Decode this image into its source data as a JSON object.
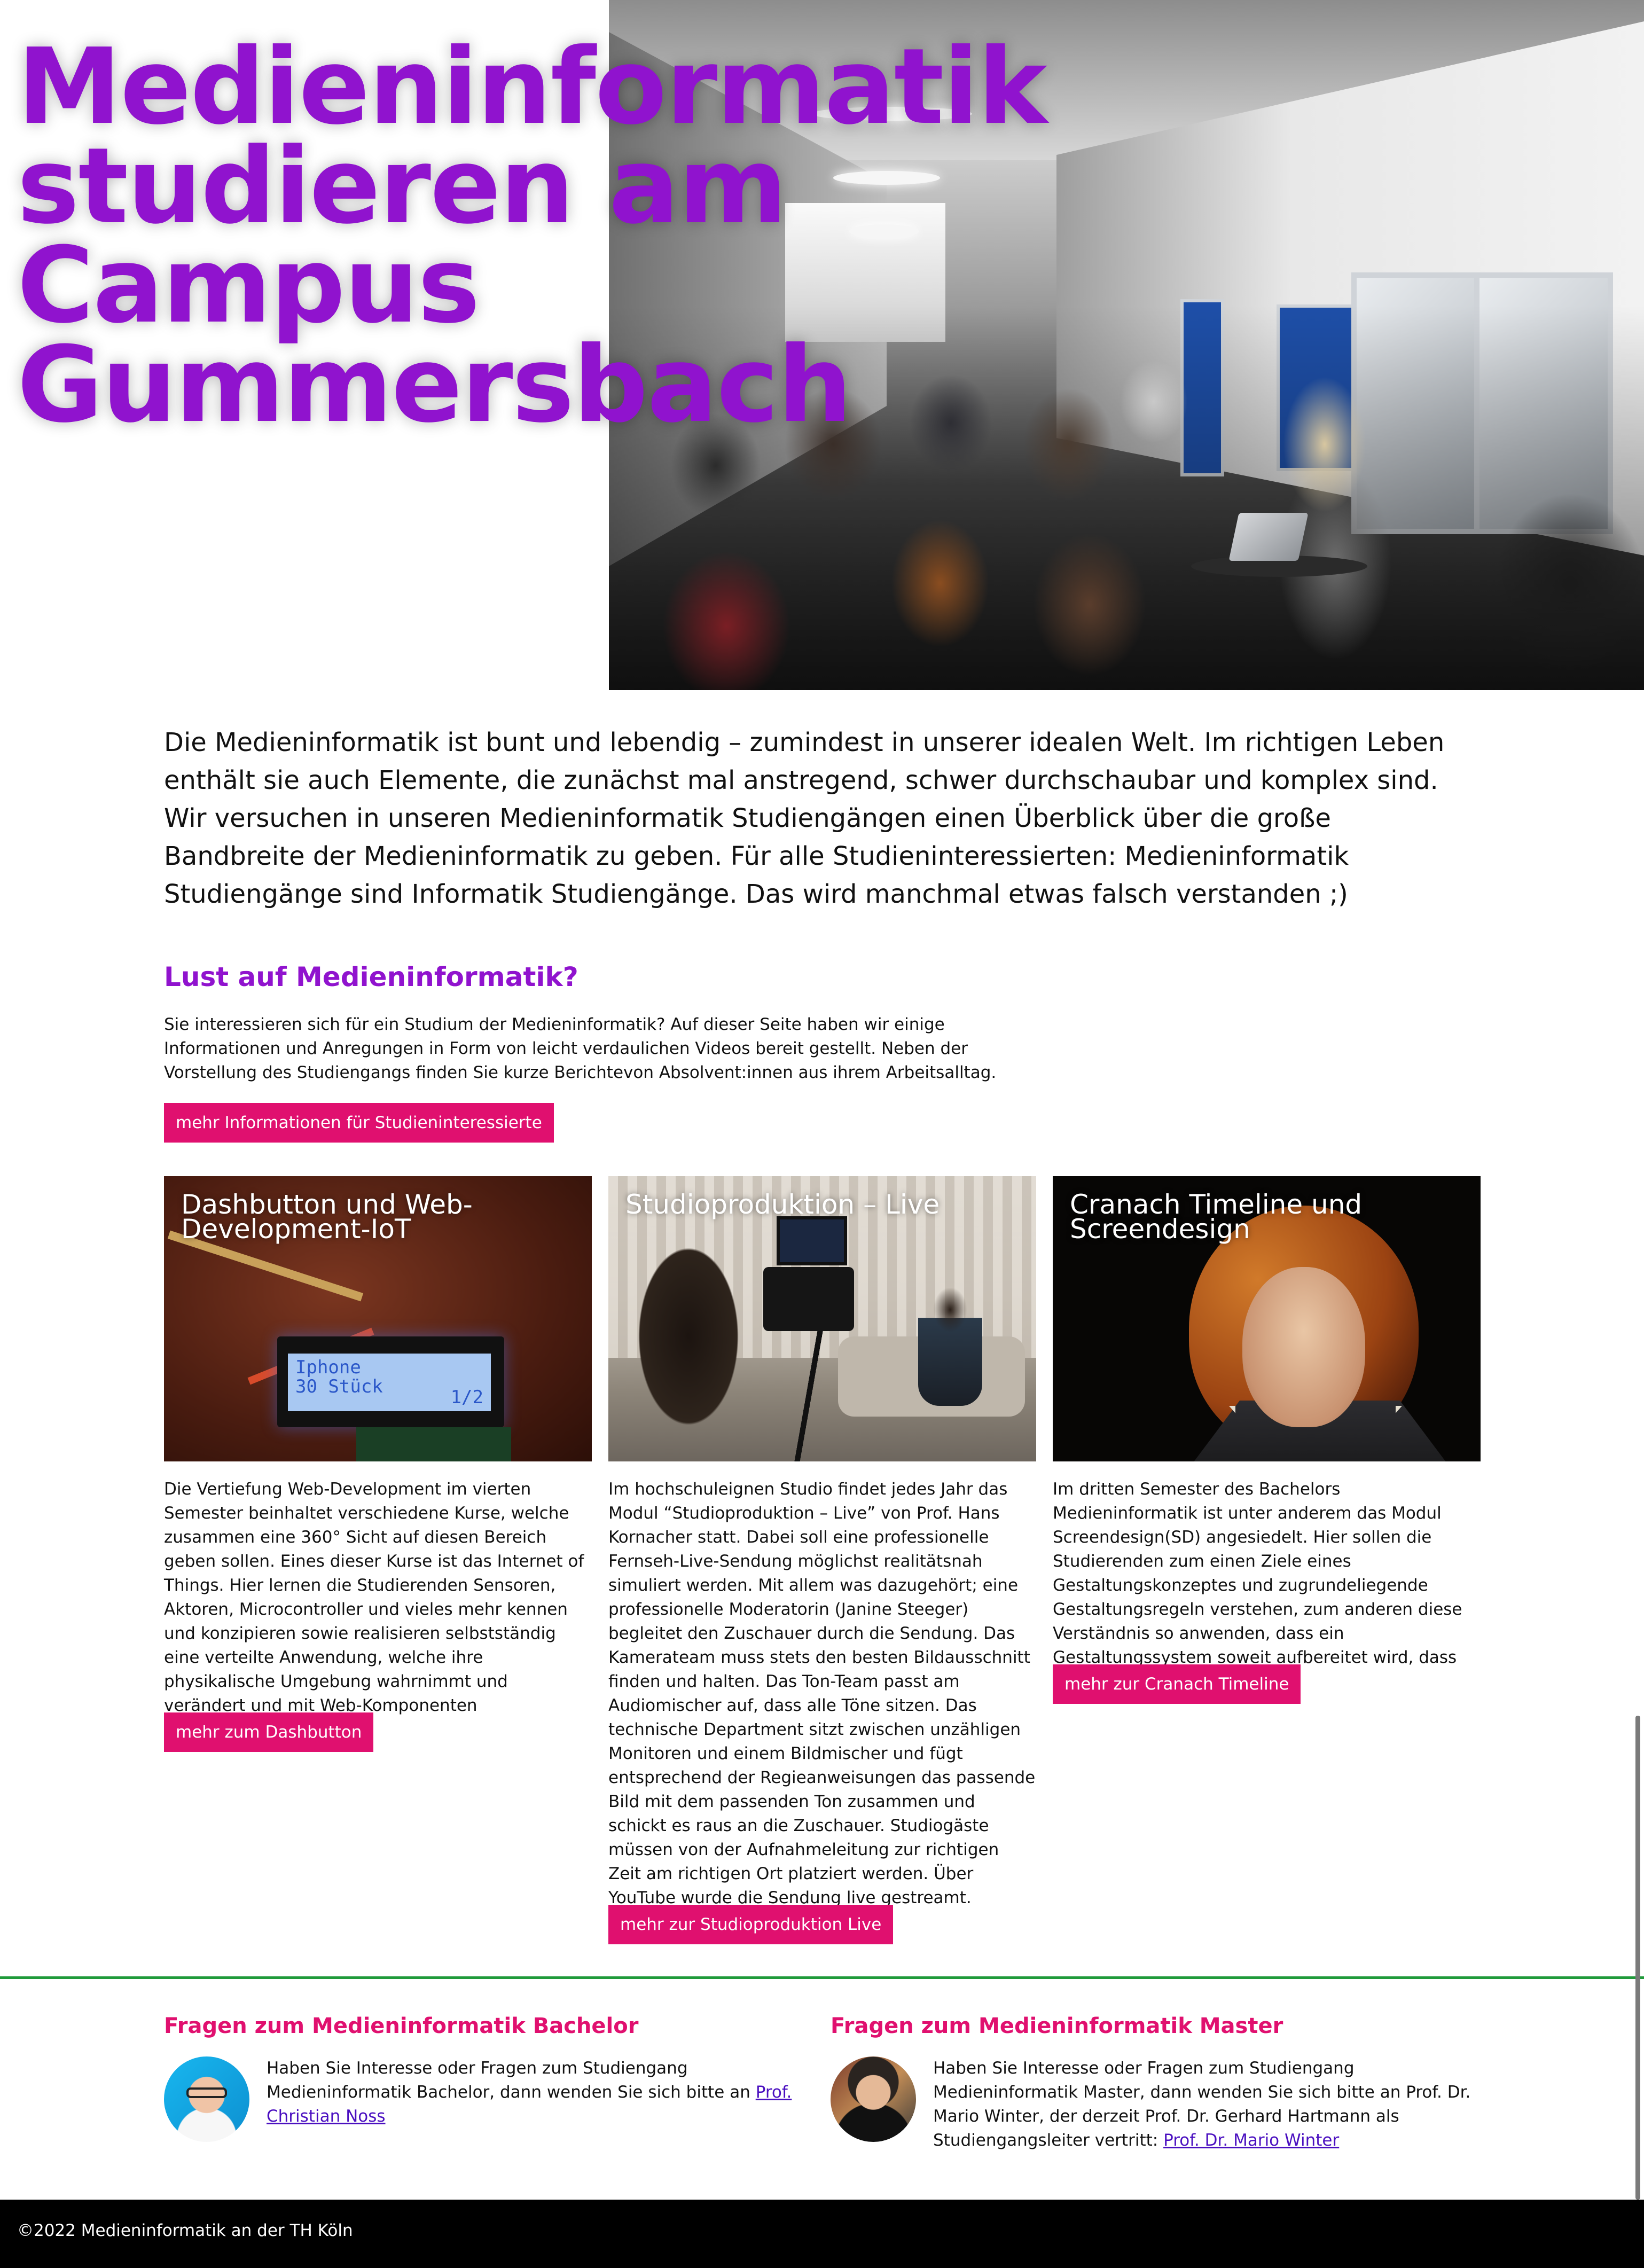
{
  "hero": {
    "title_lines": [
      "Medieninformatik",
      "studieren am",
      "Campus",
      "Gummersbach"
    ]
  },
  "intro": {
    "text": "Die Medieninformatik ist bunt und lebendig – zumindest in unserer idealen Welt. Im richtigen Leben enthält sie auch Elemente, die zunächst mal anstregend, schwer durchschaubar und komplex sind. Wir versuchen in unseren Medieninformatik Studiengängen einen Überblick über die große Bandbreite der Medieninformatik zu geben. Für alle Studieninteressierten: Medieninformatik Studiengänge sind Informatik Studiengänge. Das wird manchmal etwas falsch verstanden ;)"
  },
  "lust": {
    "heading": "Lust auf Medieninformatik?",
    "text": "Sie interessieren sich für ein Studium der Medieninformatik? Auf dieser Seite haben wir einige Informationen und Anregungen in Form von leicht verdaulichen Videos bereit gestellt. Neben der Vorstellung des Studiengangs finden Sie kurze Berichtevon Absolvent:innen aus ihrem Arbeitsalltag.",
    "button": "mehr Informationen für Studieninteressierte"
  },
  "cards": [
    {
      "title": "Dashbutton und Web-Development-IoT",
      "lcd_line1": "Iphone",
      "lcd_line2": "30 Stück",
      "lcd_page": "1/2",
      "text": "Die Vertiefung Web-Development im vierten Semester beinhaltet verschiedene Kurse, welche zusammen eine 360° Sicht auf diesen Bereich geben sollen. Eines dieser Kurse ist das Internet of Things. Hier lernen die Studierenden Sensoren, Aktoren, Microcontroller und vieles mehr kennen und konzipieren sowie realisieren selbstständig eine verteilte Anwendung, welche ihre physikalische Umgebung wahrnimmt und verändert und mit Web-Komponenten kommuniziert.",
      "button": "mehr zum Dashbutton"
    },
    {
      "title": "Studioproduktion – Live",
      "text": "Im hochschuleignen Studio findet jedes Jahr das Modul “Studioproduktion – Live” von Prof. Hans Kornacher statt. Dabei soll eine professionelle Fernseh-Live-Sendung möglichst realitätsnah simuliert werden. Mit allem was dazugehört; eine professionelle Moderatorin (Janine Steeger) begleitet den Zuschauer durch die Sendung. Das Kamerateam muss stets den besten Bildausschnitt finden und halten. Das Ton-Team passt am Audiomischer auf, dass alle Töne sitzen. Das techni­sche Department sitzt zwischen unzähligen Monitoren und einem Bildmischer und fügt entsprechend der Regieanweisungen das passende Bild mit dem passenden Ton zusammen und schickt es raus an die Zuschauer. Studiogäste müssen von der Aufnahmeleitung zur richtigen Zeit am richtigen Ort platziert werden. Über YouTube wurde die Sendung live gestreamt.",
      "button": "mehr zur Studioproduktion Live"
    },
    {
      "title": "Cranach Timeline und Screendesign",
      "text": "Im dritten Semester des Bachelors Medieninformatik ist unter anderem das Modul Screendesign(SD) ange­siedelt. Hier sollen die Studierenden zum einen Ziele eines Gestaltungskonzeptes und zugrundeliegende Gestaltungsregeln verstehen, zum anderen diese Verständnis so anwenden, dass ein Gestaltungssystem soweit aufbereitet wird, dass es implementiertbar ist.",
      "button": "mehr zur Cranach Timeline"
    }
  ],
  "contacts": {
    "bachelor": {
      "heading": "Fragen zum Medieninformatik Bachelor",
      "text": "Haben Sie Interesse oder Fragen zum Studiengang Medieninformatik Bachelor, dann wenden Sie sich bitte an ",
      "link": "Prof. Christian Noss"
    },
    "master": {
      "heading": "Fragen zum Medieninformatik Master",
      "text": "Haben Sie Interesse oder Fragen zum Studiengang Medieninformatik Master, dann wenden Sie sich bitte an Prof. Dr. Mario Winter, der derzeit Prof. Dr. Gerhard Hartmann als Studiengangsleiter vertritt: ",
      "link": "Prof. Dr. Mario Winter"
    }
  },
  "footer": {
    "copyright": "©2022 Medieninformatik an der TH Köln"
  },
  "colors": {
    "accent_purple": "#9013ce",
    "accent_pink": "#e0106f",
    "divider_green": "#1f9a3a"
  }
}
